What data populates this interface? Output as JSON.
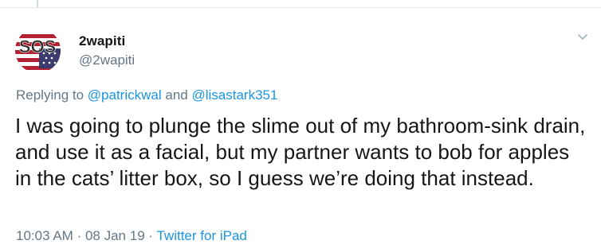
{
  "tweet": {
    "display_name": "2wapiti",
    "handle": "@2wapiti",
    "avatar_text": "SOS",
    "reply": {
      "prefix": "Replying to",
      "mention_1": "@patrickwal",
      "conjunction": "and",
      "mention_2": "@lisastark351"
    },
    "text": "I was going to plunge the slime out of my bathroom-sink drain, and use it as a facial, but my partner wants to bob for apples in the cats’ litter box, so I guess we’re doing that instead.",
    "time": "10:03 AM",
    "separator": "·",
    "date": "08 Jan 19",
    "source": "Twitter for iPad"
  },
  "icons": {
    "menu": "chevron-down-icon"
  },
  "colors": {
    "link": "#1b95e0",
    "secondary_text": "#657786",
    "primary_text": "#14171a",
    "divider": "#e1e8ed"
  }
}
